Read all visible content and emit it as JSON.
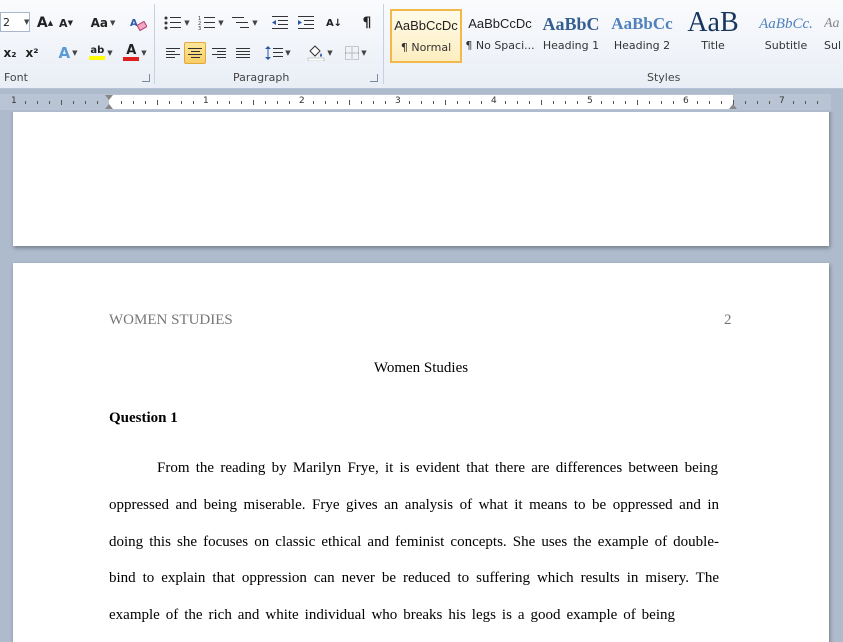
{
  "ribbon": {
    "font_size_value": "2",
    "group_labels": {
      "font": "Font",
      "paragraph": "Paragraph",
      "styles": "Styles"
    },
    "font": {
      "grow": "A",
      "shrink": "A",
      "change_case": "Aa",
      "subscript": "x₂",
      "superscript": "x²",
      "text_effects": "A",
      "highlight": "ab",
      "font_color": "A"
    },
    "paragraph": {
      "pilcrow": "¶",
      "sort": "A↓"
    },
    "styles": [
      {
        "sample": "AaBbCcDc",
        "name": "¶ Normal",
        "selected": true
      },
      {
        "sample": "AaBbCcDc",
        "name": "¶ No Spaci..."
      },
      {
        "sample": "AaBbC",
        "name": "Heading 1"
      },
      {
        "sample": "AaBbCc",
        "name": "Heading 2"
      },
      {
        "sample": "AaB",
        "name": "Title"
      },
      {
        "sample": "AaBbCc.",
        "name": "Subtitle"
      },
      {
        "sample": "Aa",
        "name": "Sul"
      }
    ],
    "colors": {
      "highlight": "#ffff00",
      "font_color": "#e02020",
      "accent": "#f0b94a"
    }
  },
  "ruler": {
    "numbers": [
      "1",
      "1",
      "2",
      "3",
      "4",
      "5",
      "6",
      "7"
    ]
  },
  "document": {
    "running_head": "WOMEN STUDIES",
    "page_number": "2",
    "title": "Women Studies",
    "question": "Question 1",
    "lines": [
      "From the reading by Marilyn Frye, it is evident that there are differences between being",
      "oppressed and being miserable. Frye gives an analysis of what it means to be oppressed and in",
      "doing this she focuses on classic ethical and feminist concepts. She uses the example of double-",
      "bind to explain that oppression can never be reduced to suffering which results in misery. The",
      "example of the rich and white individual who breaks his legs is a good example of being"
    ]
  }
}
